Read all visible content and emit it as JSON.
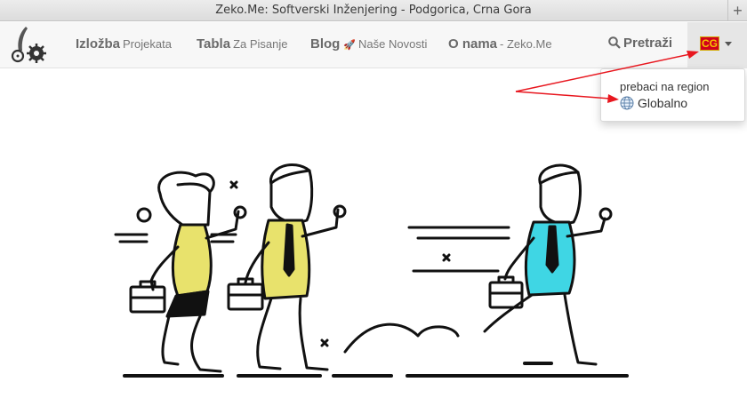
{
  "window": {
    "title": "Zeko.Me: Softverski Inženjering - Podgorica, Crna Gora",
    "new_tab_label": "+"
  },
  "nav": {
    "items": [
      {
        "bold": "Izložba",
        "sub": "Projekata"
      },
      {
        "bold": "Tabla",
        "sub": "Za Pisanje"
      },
      {
        "bold": "Blog",
        "sub": "Naše Novosti"
      },
      {
        "bold": "O nama",
        "sub": "- Zeko.Me"
      }
    ],
    "search_label": "Pretraži",
    "region_code": "CG"
  },
  "region_dropdown": {
    "header": "prebaci na region",
    "option": "Globalno"
  },
  "colors": {
    "accent_yellow": "#e8e26c",
    "accent_cyan": "#3fd6e4",
    "arrow_red": "#e8171f",
    "flag_red": "#d0021b",
    "flag_gold": "#f5c400"
  },
  "icons": [
    "logo-icon",
    "rocket-icon",
    "search-icon",
    "flag-icon",
    "chevron-down-icon",
    "globe-icon"
  ]
}
